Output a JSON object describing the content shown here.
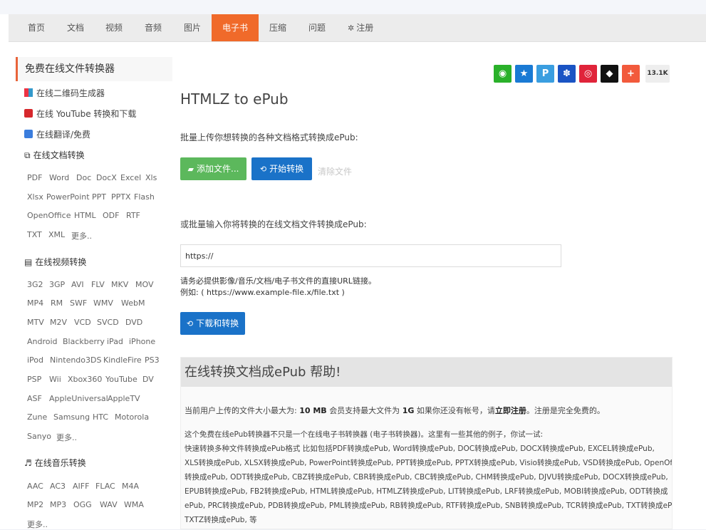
{
  "nav": {
    "items": [
      "首页",
      "文档",
      "视频",
      "音频",
      "图片",
      "电子书",
      "压缩",
      "问题"
    ],
    "active": "电子书",
    "register": "注册"
  },
  "sidebar": {
    "title": "免费在线文件转换器",
    "links": [
      "在线二维码生成器",
      "在线 YouTube 转换和下载",
      "在线翻译/免费"
    ],
    "doc_section": "在线文档转换",
    "doc_tags": [
      "PDF",
      "Word",
      "Doc",
      "DocX",
      "Excel",
      "Xls",
      "Xlsx",
      "PowerPoint",
      "PPT",
      "PPTX",
      "Flash",
      "OpenOffice",
      "HTML",
      "ODF",
      "RTF",
      "TXT",
      "XML",
      "更多.."
    ],
    "video_section": "在线视频转换",
    "video_tags": [
      "3G2",
      "3GP",
      "AVI",
      "FLV",
      "MKV",
      "MOV",
      "MP4",
      "RM",
      "SWF",
      "WMV",
      "WebM",
      "MTV",
      "M2V",
      "VCD",
      "SVCD",
      "DVD",
      "Android",
      "Blackberry",
      "iPad",
      "iPhone",
      "iPod",
      "Nintendo3DS",
      "KindleFire",
      "PS3",
      "PSP",
      "Wii",
      "Xbox360",
      "YouTube",
      "DV",
      "ASF",
      "AppleUniversal",
      "AppleTV",
      "Zune",
      "Samsung",
      "HTC",
      "Motorola",
      "Sanyo",
      "更多.."
    ],
    "audio_section": "在线音乐转换",
    "audio_tags": [
      "AAC",
      "AC3",
      "AIFF",
      "FLAC",
      "M4A",
      "MP2",
      "MP3",
      "OGG",
      "WAV",
      "WMA"
    ],
    "audio_more": "更多.."
  },
  "share": {
    "count": "13.1K",
    "colors": [
      "#2ab12a",
      "#1a7ad4",
      "#3a9ee0",
      "#1a54c4",
      "#e0243a",
      "#111111",
      "#f25a3c"
    ],
    "icons": [
      "wechat-icon",
      "qzone-icon",
      "tencent-weibo-icon",
      "baidu-icon",
      "sina-weibo-icon",
      "qq-icon",
      "more-share-icon"
    ],
    "glyphs": [
      "◉",
      "★",
      "P",
      "✽",
      "◎",
      "◆",
      "+"
    ]
  },
  "main": {
    "title": "HTMLZ to ePub",
    "upload_label": "批量上传你想转换的各种文档格式转换成ePub:",
    "add_files": "添加文件...",
    "start_convert": "开始转换",
    "clear_files": "清除文件",
    "url_label": "或批量输入你将转换的在线文档文件转换成ePub:",
    "url_value": "https://",
    "note1": "请务必提供影像/音乐/文档/电子书文件的直接URL链接。",
    "note2": "例如: ( https://www.example-file.x/file.txt )",
    "download_convert": "下载和转换"
  },
  "help": {
    "title": "在线转换文档成ePub 帮助!",
    "p1_a": "当前用户上传的文件大小最大为:",
    "p1_size": "10 MB",
    "p1_b": "会员支持最大文件为",
    "p1_size2": "1G",
    "p1_c": "如果你还没有帐号，请",
    "p1_link": "立即注册",
    "p1_d": "。注册是完全免费的。",
    "lines": [
      "这个免费在线ePub转换器不只是一个在线电子书转换器 (电子书转换器)。这里有一些其他的例子，你试一试:",
      "快速转换多种文件转换成ePub格式 比如包括PDF转换成ePub, Word转换成ePub, DOC转换成ePub, DOCX转换成ePub, EXCEL转换成ePub,",
      "XLS转换成ePub, XLSX转换成ePub, PowerPoint转换成ePub, PPT转换成ePub, PPTX转换成ePub, Visio转换成ePub, VSD转换成ePub, OpenOffice",
      "转换成ePub, ODT转换成ePub, CBZ转换成ePub, CBR转换成ePub, CBC转换成ePub, CHM转换成ePub, DJVU转换成ePub, DOCX转换成ePub,",
      "EPUB转换成ePub, FB2转换成ePub, HTML转换成ePub, HTMLZ转换成ePub, LIT转换成ePub, LRF转换成ePub, MOBI转换成ePub, ODT转换成",
      "ePub, PRC转换成ePub, PDB转换成ePub, PML转换成ePub, RB转换成ePub, RTF转换成ePub, SNB转换成ePub, TCR转换成ePub, TXT转换成ePub,",
      "TXTZ转换成ePub, 等"
    ]
  }
}
